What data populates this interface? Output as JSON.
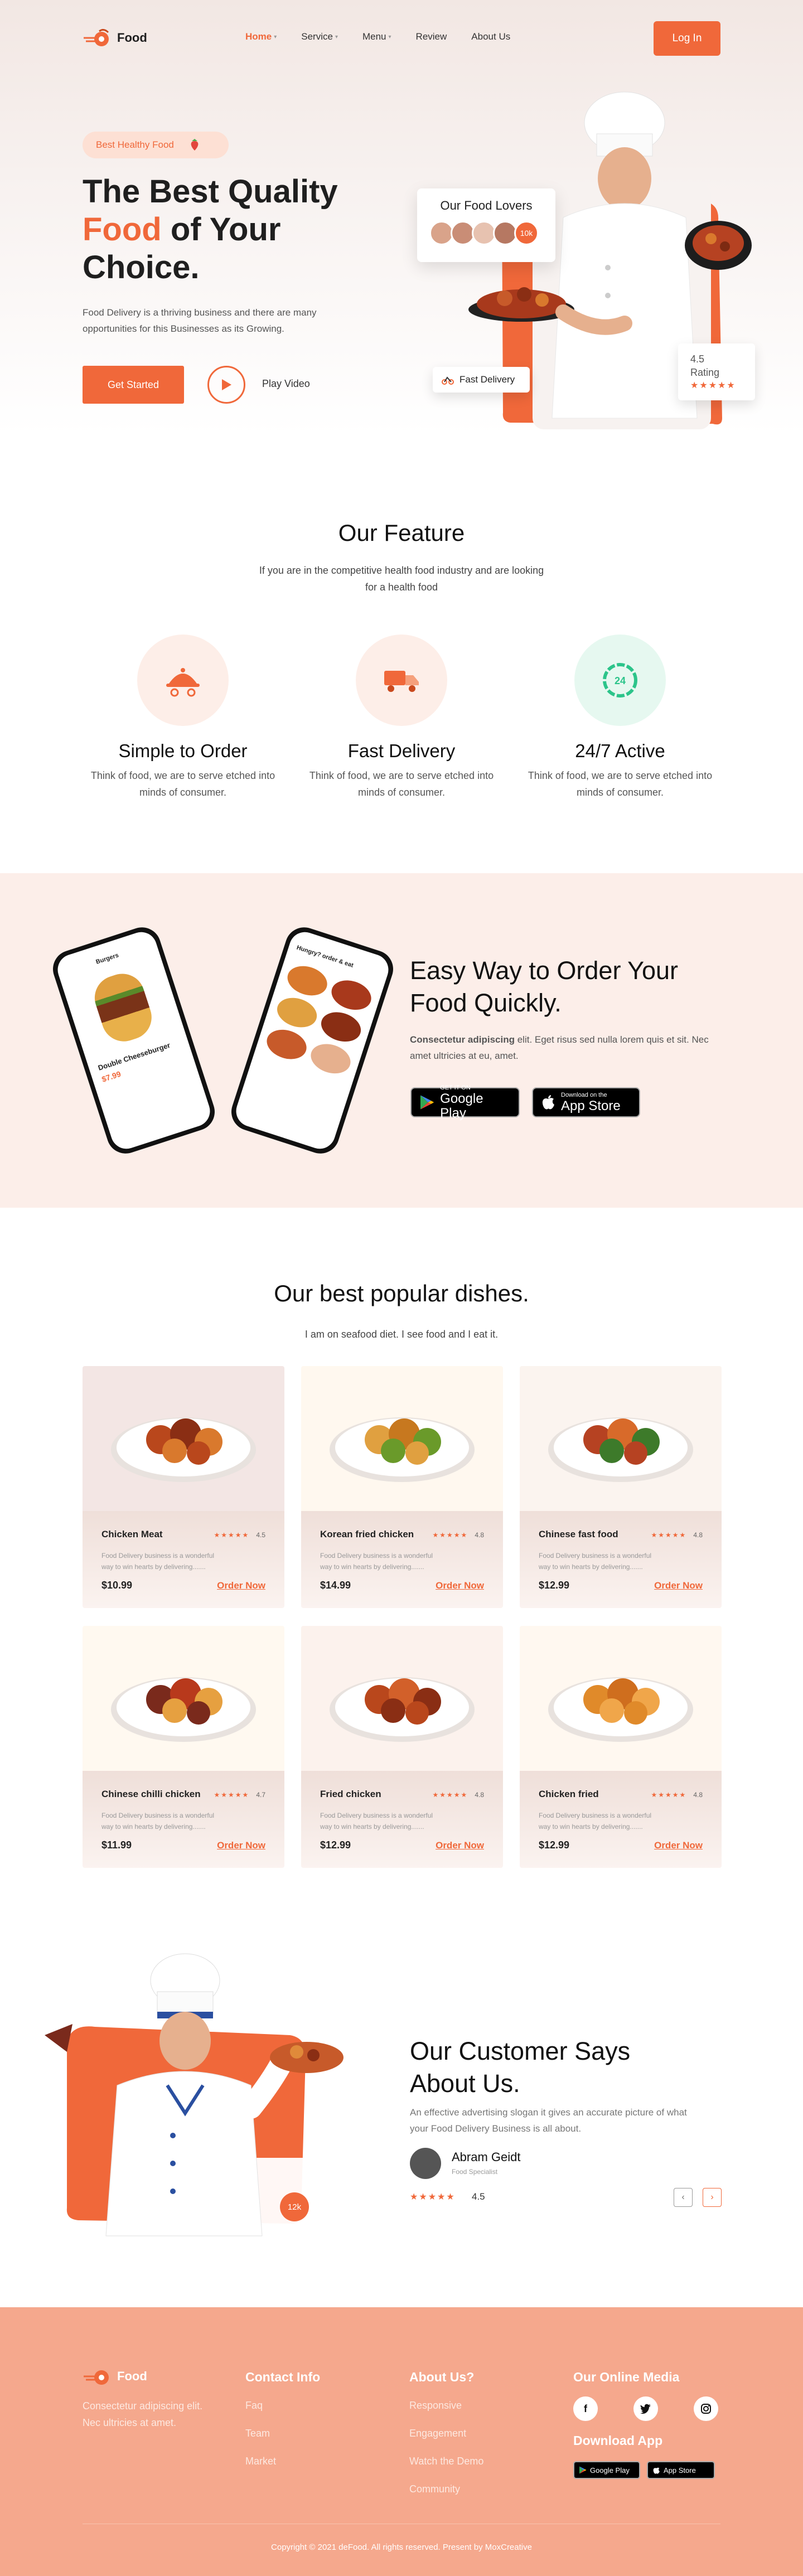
{
  "brand": {
    "name": "Food",
    "accent": "#f0683a"
  },
  "nav": {
    "items": [
      "Home",
      "Service",
      "Menu",
      "Review",
      "About Us"
    ],
    "login": "Log In"
  },
  "hero": {
    "badge": "Best Healthy Food",
    "title_line1": "The Best Quality",
    "title_accent": "Food",
    "title_rest": " of Your",
    "title_line3": "Choice.",
    "description": "Food Delivery is a thriving business and there are many opportunities for this Businesses as its Growing.",
    "cta": "Get Started",
    "play": "Play Video",
    "lovers_title": "Our Food Lovers",
    "lovers_count": "10k",
    "fast_delivery": "Fast Delivery",
    "rating_value": "4.5",
    "rating_label": "Rating",
    "rating_stars": 4.5
  },
  "features": {
    "title": "Our Feature",
    "subtitle": "If you are in the competitive health food industry and are looking for a health food",
    "items": [
      {
        "title": "Simple to Order",
        "desc": "Think of food, we are  to serve etched into minds of consumer.",
        "icon": "serving-cloche-icon",
        "bg": "#fdeee8"
      },
      {
        "title": "Fast Delivery",
        "desc": "Think of food, we are  to serve etched into minds of consumer.",
        "icon": "delivery-truck-icon",
        "bg": "#fdeee8"
      },
      {
        "title": "24/7 Active",
        "desc": "Think of food, we are  to serve etched into minds of consumer.",
        "icon": "clock-24-icon",
        "bg": "#e6f8f0"
      }
    ]
  },
  "app": {
    "title": "Easy Way to Order Your Food Quickly.",
    "desc_bold": "Consectetur adipiscing",
    "desc_rest": " elit. Eget risus sed nulla lorem quis et sit. Nec amet ultricies at eu, amet.",
    "google_top": "GET IT ON",
    "google_main": "Google Play",
    "apple_top": "Download on the",
    "apple_main": "App Store",
    "phone1": {
      "header": "Burgers",
      "product": "Double Cheeseburger",
      "price": "$7.99"
    },
    "phone2": {
      "header": "Hungry? order & eat"
    }
  },
  "dishes": {
    "title": "Our best popular dishes.",
    "subtitle": "I am on seafood diet. I see food and I eat it.",
    "order_label": "Order Now",
    "items": [
      {
        "name": "Chicken Meat",
        "rating": "4.5",
        "price": "$10.99",
        "desc": "Food Delivery business is a wonderful way to win hearts by delivering.......",
        "bg": "#f3e6e4"
      },
      {
        "name": "Korean fried chicken",
        "rating": "4.8",
        "price": "$14.99",
        "desc": "Food Delivery business is a wonderful way to win hearts by delivering.......",
        "bg": "#fff8ef"
      },
      {
        "name": "Chinese fast food",
        "rating": "4.8",
        "price": "$12.99",
        "desc": "Food Delivery business is a wonderful way to win hearts by delivering.......",
        "bg": "#fbf4ef"
      },
      {
        "name": "Chinese chilli chicken",
        "rating": "4.7",
        "price": "$11.99",
        "desc": "Food Delivery business is a wonderful way to win hearts by delivering.......",
        "bg": "#fff9f0"
      },
      {
        "name": "Fried chicken",
        "rating": "4.8",
        "price": "$12.99",
        "desc": "Food Delivery business is a wonderful way to win hearts by delivering.......",
        "bg": "#fcf2ed"
      },
      {
        "name": "Chicken fried",
        "rating": "4.8",
        "price": "$12.99",
        "desc": "Food Delivery business is a wonderful way to win hearts by delivering.......",
        "bg": "#fff8f0"
      }
    ]
  },
  "testimonial": {
    "title": "Our Customer Says About Us.",
    "desc": "An effective advertising slogan it gives an accurate picture of what your Food Delivery Business is all about.",
    "name": "Abram Geidt",
    "role": "Food Specialist",
    "rating": "4.5",
    "badge": "12k"
  },
  "footer": {
    "tagline": "Consectetur adipiscing elit. Nec ultricies at amet.",
    "contact_title": "Contact Info",
    "contact_links": [
      "Faq",
      "Team",
      "Market"
    ],
    "about_title": "About Us?",
    "about_links": [
      "Responsive",
      "Engagement",
      "Watch the Demo",
      "Community"
    ],
    "media_title": "Our Online Media",
    "download_title": "Download App",
    "copyright": "Copyright © 2021 deFood. All rights reserved. Present by MoxCreative"
  }
}
